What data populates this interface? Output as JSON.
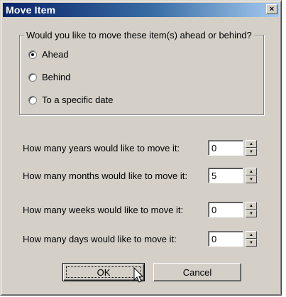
{
  "window": {
    "title": "Move Item",
    "close_glyph": "×"
  },
  "direction_group": {
    "legend": "Would you like to move these item(s) ahead or behind?",
    "options": [
      {
        "label": "Ahead",
        "checked": true
      },
      {
        "label": "Behind",
        "checked": false
      },
      {
        "label": "To a specific date",
        "checked": false
      }
    ]
  },
  "fields": [
    {
      "label": "How many years would like to move it:",
      "value": "0"
    },
    {
      "label": "How many months would like to move it:",
      "value": "5"
    },
    {
      "label": "How many weeks would like to move it:",
      "value": "0"
    },
    {
      "label": "How many days would like to move it:",
      "value": "0"
    }
  ],
  "buttons": {
    "ok": "OK",
    "cancel": "Cancel"
  },
  "icons": {
    "close": "close-icon",
    "spin_up": "arrow-up-icon",
    "spin_down": "arrow-down-icon",
    "cursor": "mouse-pointer-icon"
  },
  "colors": {
    "titlebar_start": "#0a246a",
    "titlebar_end": "#a6caf0",
    "dialog_face": "#d4d0c8"
  }
}
